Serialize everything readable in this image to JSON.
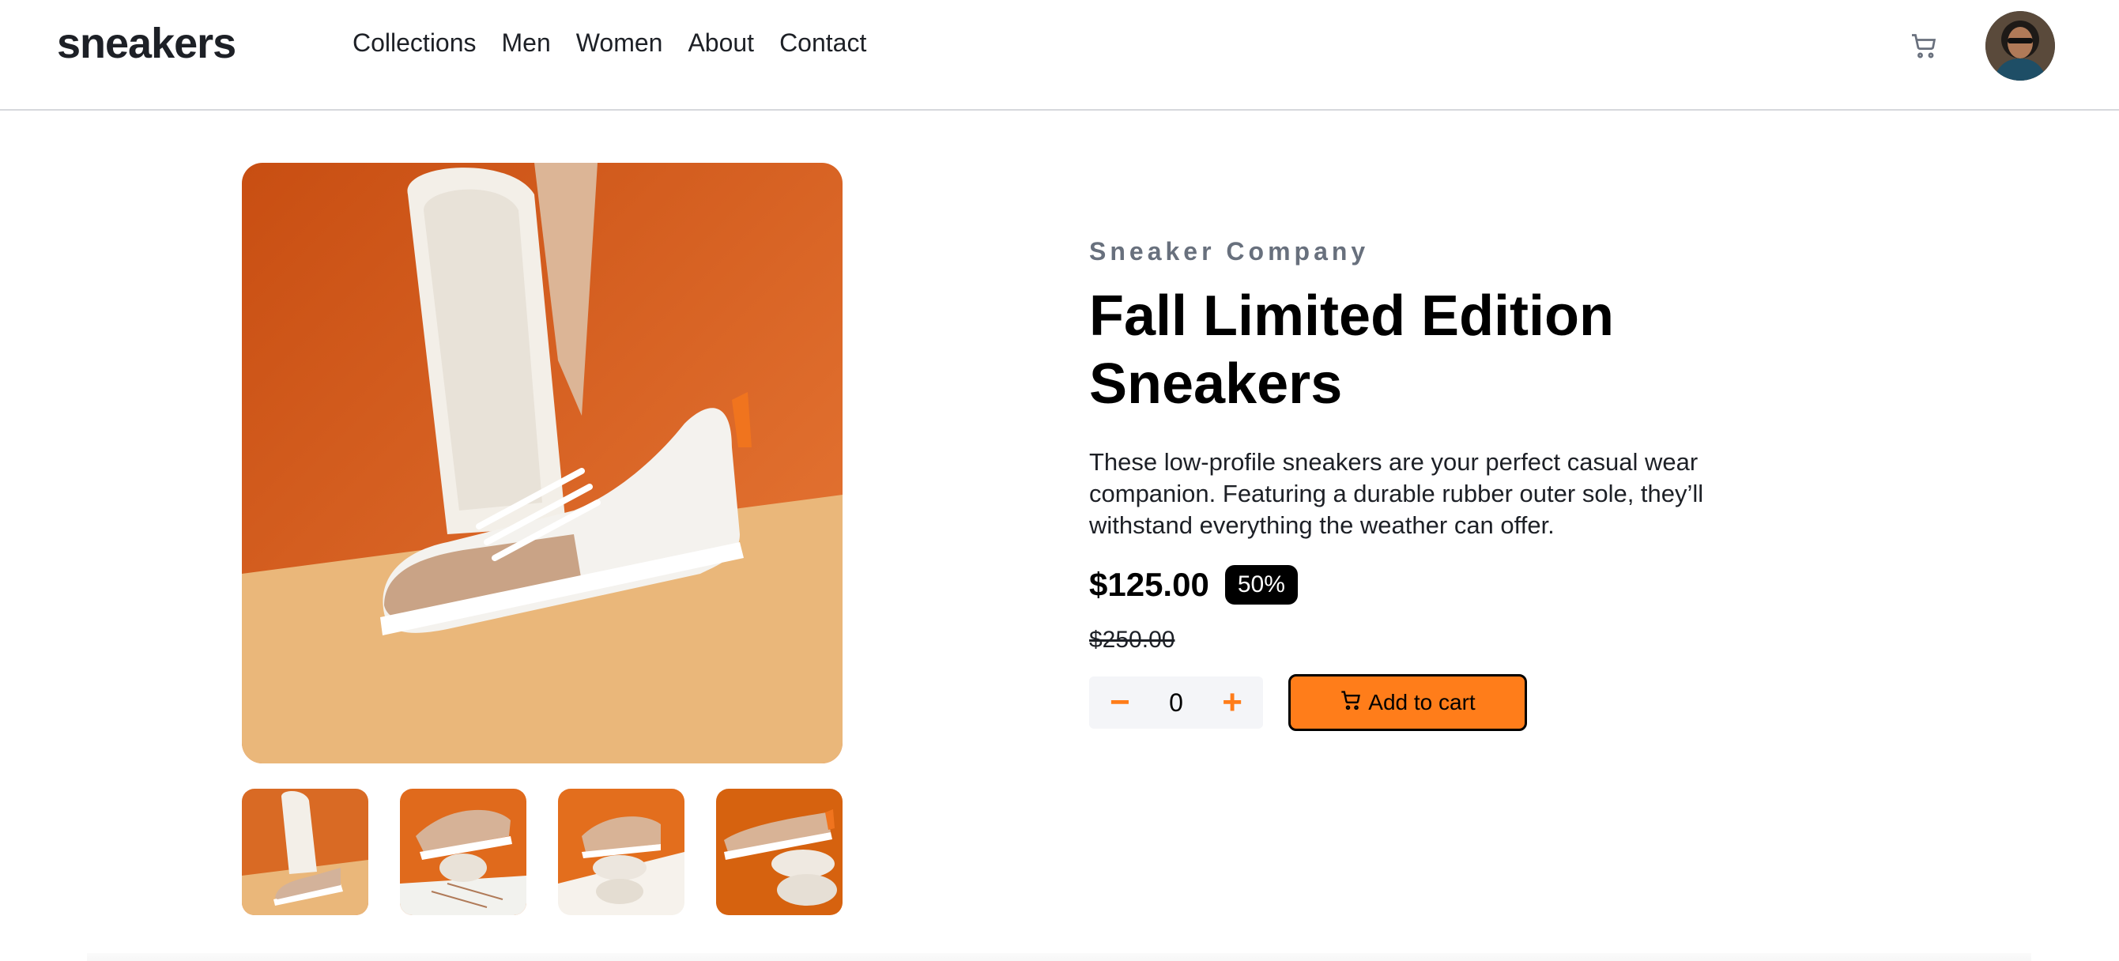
{
  "header": {
    "logo": "sneakers",
    "nav": [
      "Collections",
      "Men",
      "Women",
      "About",
      "Contact"
    ],
    "icons": {
      "cart": "cart-icon",
      "avatar": "user-avatar"
    }
  },
  "product": {
    "company": "Sneaker Company",
    "title": "Fall Limited Edition Sneakers",
    "description": "These low-profile sneakers are your perfect casual wear companion. Featuring a durable rubber outer sole, they’ll withstand everything the weather can offer.",
    "price": "$125.00",
    "discount": "50%",
    "old_price": "$250.00",
    "quantity": "0",
    "minus": "−",
    "plus": "+",
    "add_to_cart": "Add to cart"
  },
  "colors": {
    "accent": "#ff7d1a",
    "text": "#1d2026",
    "muted": "#68707d"
  }
}
